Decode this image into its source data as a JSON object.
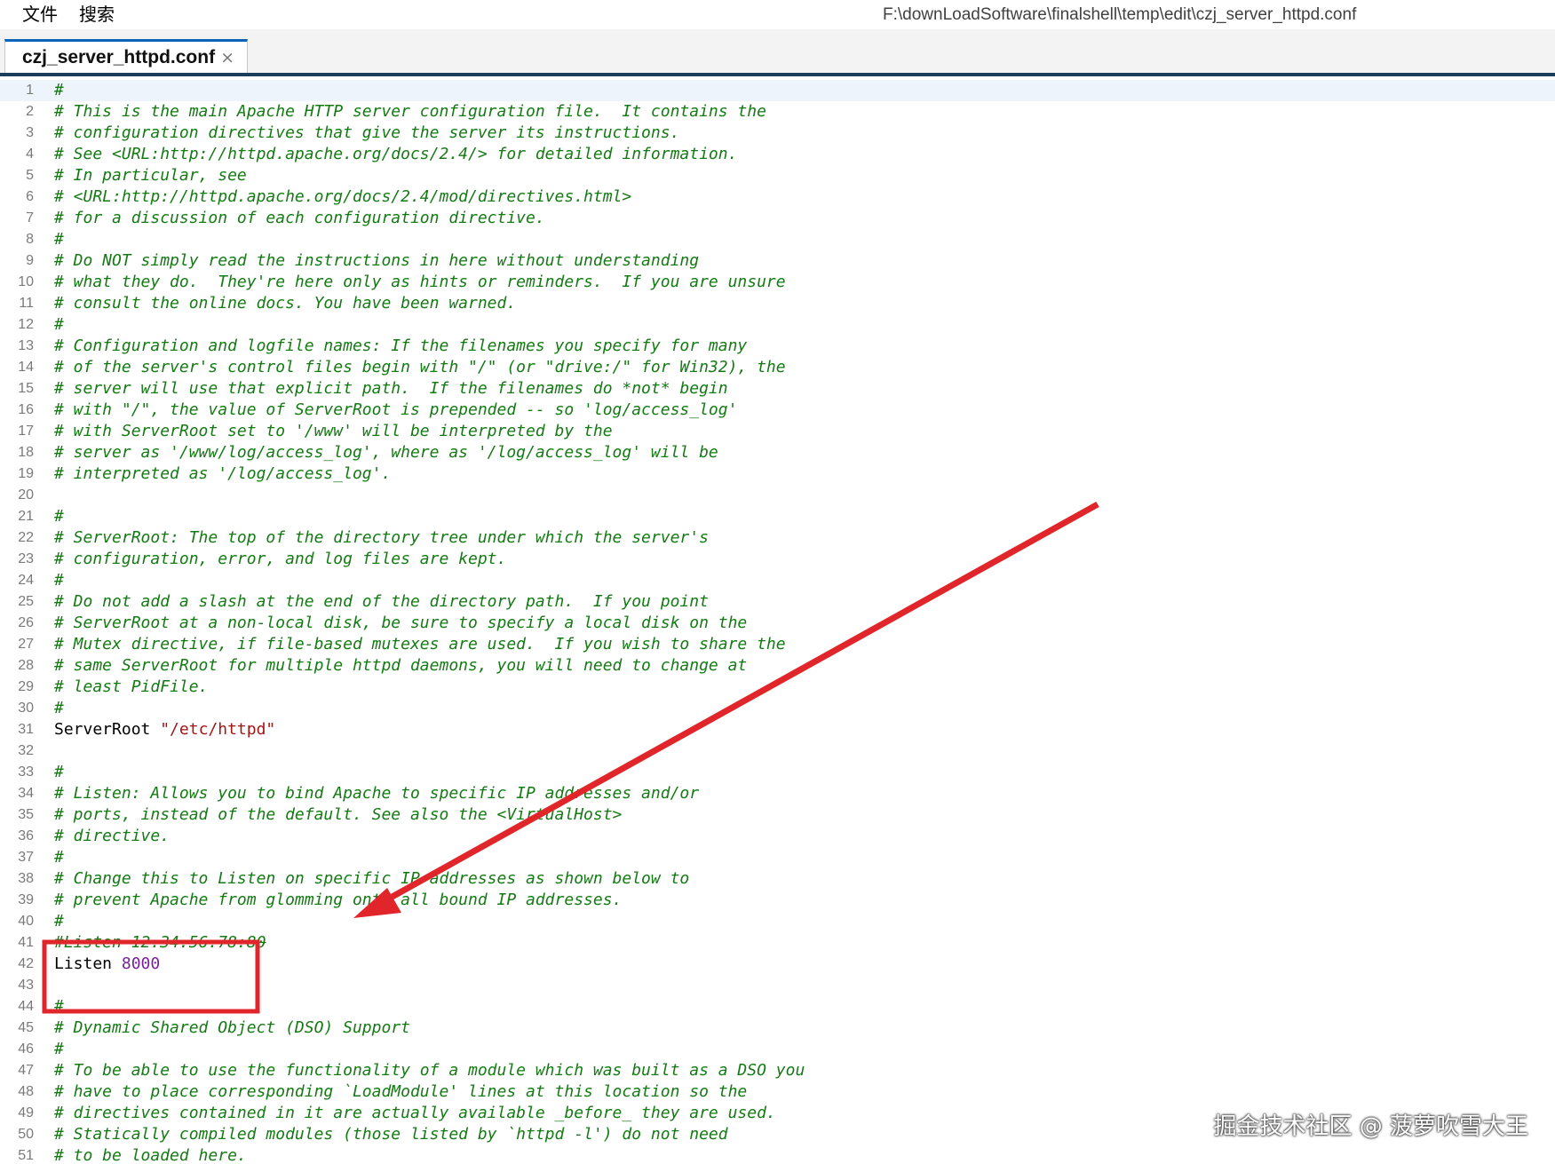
{
  "menu": [
    {
      "label": "文件",
      "name": "menu-file"
    },
    {
      "label": "搜索",
      "name": "menu-search"
    }
  ],
  "window": {
    "path": "F:\\downLoadSoftware\\finalshell\\temp\\edit\\czj_server_httpd.conf"
  },
  "tab": {
    "label": "czj_server_httpd.conf",
    "close": "×"
  },
  "lines": [
    {
      "n": "1",
      "t": "#",
      "k": "comment"
    },
    {
      "n": "2",
      "t": "# This is the main Apache HTTP server configuration file.  It contains the",
      "k": "comment"
    },
    {
      "n": "3",
      "t": "# configuration directives that give the server its instructions.",
      "k": "comment"
    },
    {
      "n": "4",
      "t": "# See <URL:http://httpd.apache.org/docs/2.4/> for detailed information.",
      "k": "comment"
    },
    {
      "n": "5",
      "t": "# In particular, see",
      "k": "comment"
    },
    {
      "n": "6",
      "t": "# <URL:http://httpd.apache.org/docs/2.4/mod/directives.html>",
      "k": "comment"
    },
    {
      "n": "7",
      "t": "# for a discussion of each configuration directive.",
      "k": "comment"
    },
    {
      "n": "8",
      "t": "#",
      "k": "comment"
    },
    {
      "n": "9",
      "t": "# Do NOT simply read the instructions in here without understanding",
      "k": "comment"
    },
    {
      "n": "10",
      "t": "# what they do.  They're here only as hints or reminders.  If you are unsure",
      "k": "comment"
    },
    {
      "n": "11",
      "t": "# consult the online docs. You have been warned.",
      "k": "comment"
    },
    {
      "n": "12",
      "t": "#",
      "k": "comment"
    },
    {
      "n": "13",
      "t": "# Configuration and logfile names: If the filenames you specify for many",
      "k": "comment"
    },
    {
      "n": "14",
      "t": "# of the server's control files begin with \"/\" (or \"drive:/\" for Win32), the",
      "k": "comment"
    },
    {
      "n": "15",
      "t": "# server will use that explicit path.  If the filenames do *not* begin",
      "k": "comment"
    },
    {
      "n": "16",
      "t": "# with \"/\", the value of ServerRoot is prepended -- so 'log/access_log'",
      "k": "comment"
    },
    {
      "n": "17",
      "t": "# with ServerRoot set to '/www' will be interpreted by the",
      "k": "comment"
    },
    {
      "n": "18",
      "t": "# server as '/www/log/access_log', where as '/log/access_log' will be",
      "k": "comment"
    },
    {
      "n": "19",
      "t": "# interpreted as '/log/access_log'.",
      "k": "comment"
    },
    {
      "n": "20",
      "t": "",
      "k": "plain"
    },
    {
      "n": "21",
      "t": "#",
      "k": "comment"
    },
    {
      "n": "22",
      "t": "# ServerRoot: The top of the directory tree under which the server's",
      "k": "comment"
    },
    {
      "n": "23",
      "t": "# configuration, error, and log files are kept.",
      "k": "comment"
    },
    {
      "n": "24",
      "t": "#",
      "k": "comment"
    },
    {
      "n": "25",
      "t": "# Do not add a slash at the end of the directory path.  If you point",
      "k": "comment"
    },
    {
      "n": "26",
      "t": "# ServerRoot at a non-local disk, be sure to specify a local disk on the",
      "k": "comment"
    },
    {
      "n": "27",
      "t": "# Mutex directive, if file-based mutexes are used.  If you wish to share the",
      "k": "comment"
    },
    {
      "n": "28",
      "t": "# same ServerRoot for multiple httpd daemons, you will need to change at",
      "k": "comment"
    },
    {
      "n": "29",
      "t": "# least PidFile.",
      "k": "comment"
    },
    {
      "n": "30",
      "t": "#",
      "k": "comment"
    },
    {
      "n": "31",
      "t": "ServerRoot ",
      "k": "directive",
      "v": "\"/etc/httpd\"",
      "vk": "str"
    },
    {
      "n": "32",
      "t": "",
      "k": "plain"
    },
    {
      "n": "33",
      "t": "#",
      "k": "comment"
    },
    {
      "n": "34",
      "t": "# Listen: Allows you to bind Apache to specific IP addresses and/or",
      "k": "comment"
    },
    {
      "n": "35",
      "t": "# ports, instead of the default. See also the <VirtualHost>",
      "k": "comment"
    },
    {
      "n": "36",
      "t": "# directive.",
      "k": "comment"
    },
    {
      "n": "37",
      "t": "#",
      "k": "comment"
    },
    {
      "n": "38",
      "t": "# Change this to Listen on specific IP addresses as shown below to",
      "k": "comment"
    },
    {
      "n": "39",
      "t": "# prevent Apache from glomming onto all bound IP addresses.",
      "k": "comment"
    },
    {
      "n": "40",
      "t": "#",
      "k": "comment"
    },
    {
      "n": "41",
      "t": "#Listen 12.34.56.78:80",
      "k": "comment-strike"
    },
    {
      "n": "42",
      "t": "Listen ",
      "k": "directive",
      "v": "8000",
      "vk": "num"
    },
    {
      "n": "43",
      "t": "",
      "k": "plain"
    },
    {
      "n": "44",
      "t": "#",
      "k": "comment"
    },
    {
      "n": "45",
      "t": "# Dynamic Shared Object (DSO) Support",
      "k": "comment"
    },
    {
      "n": "46",
      "t": "#",
      "k": "comment"
    },
    {
      "n": "47",
      "t": "# To be able to use the functionality of a module which was built as a DSO you",
      "k": "comment"
    },
    {
      "n": "48",
      "t": "# have to place corresponding `LoadModule' lines at this location so the",
      "k": "comment"
    },
    {
      "n": "49",
      "t": "# directives contained in it are actually available _before_ they are used.",
      "k": "comment"
    },
    {
      "n": "50",
      "t": "# Statically compiled modules (those listed by `httpd -l') do not need",
      "k": "comment"
    },
    {
      "n": "51",
      "t": "# to be loaded here.",
      "k": "comment"
    }
  ],
  "current_line": "1",
  "annotation": {
    "color": "#e0262a"
  },
  "watermark": "掘金技术社区 @ 菠萝吹雪大王"
}
